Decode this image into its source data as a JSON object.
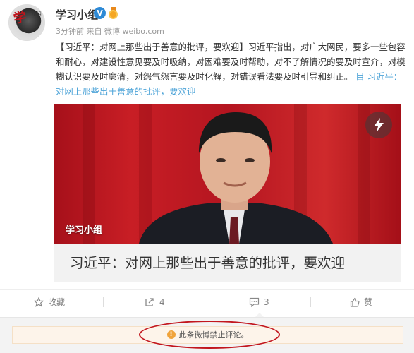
{
  "header": {
    "avatar_mark": "学",
    "avatar_small": "小组",
    "name": "学习小组",
    "verified_badge": "V",
    "meta": "3分钟前 来自 微博 weibo.com"
  },
  "post": {
    "text": "【习近平：对网上那些出于善意的批评，要欢迎】习近平指出，对广大网民，要多一些包容和耐心，对建设性意见要及时吸纳，对困难要及时帮助，对不了解情况的要及时宣介，对模糊认识要及时廓清，对怨气怨言要及时化解，对错误看法要及时引导和纠正。",
    "link_text": "目 习近平：对网上那些出于善意的批评，要欢迎"
  },
  "media_card": {
    "watermark": "学习小组",
    "flash_icon": "lightning-icon",
    "title": "习近平：对网上那些出于善意的批评，要欢迎"
  },
  "actions": [
    {
      "icon": "star-icon",
      "label": "收藏"
    },
    {
      "icon": "share-icon",
      "label": "4"
    },
    {
      "icon": "comment-icon",
      "label": "3"
    },
    {
      "icon": "thumbs-up-icon",
      "label": "赞"
    }
  ],
  "comments": {
    "notice_icon": "!",
    "notice": "此条微博禁止评论。"
  },
  "colors": {
    "link": "#4ea4d8",
    "verified": "#2e8ad6",
    "annotation_oval": "#c2161e",
    "notice_bg": "#fdf4ea"
  }
}
